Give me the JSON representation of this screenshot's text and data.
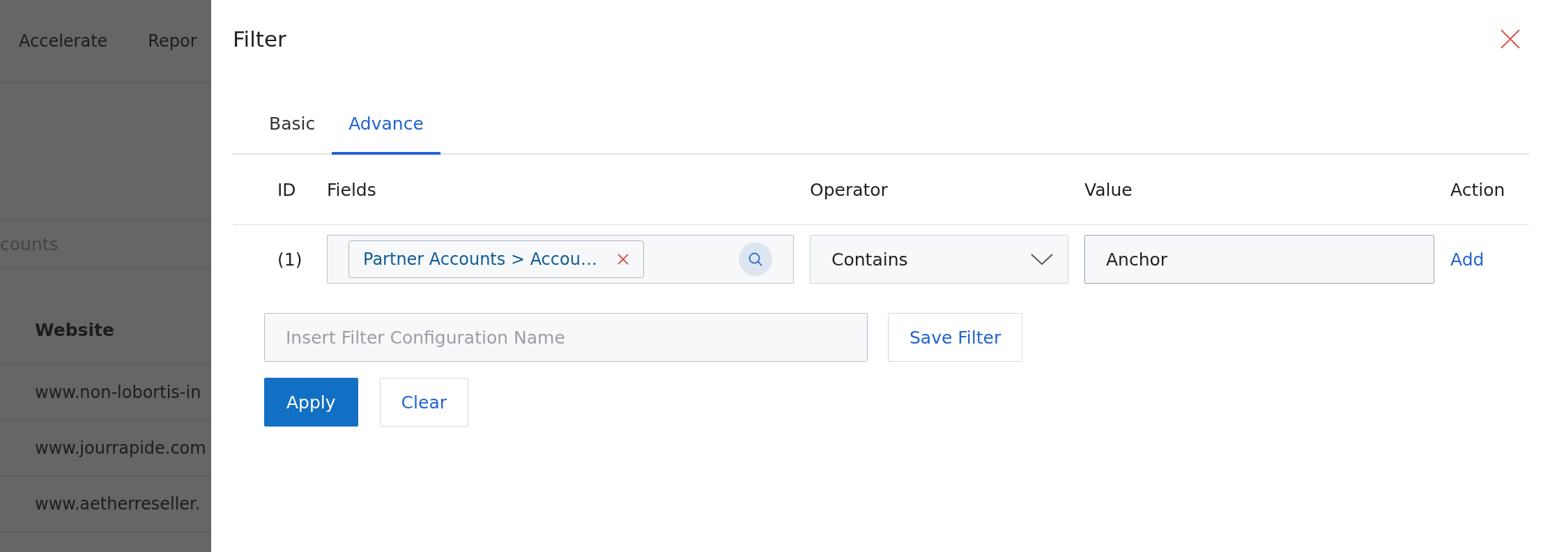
{
  "background": {
    "nav": [
      "Accelerate",
      "Repor"
    ],
    "breadcrumb": "counts",
    "table": {
      "column": "Website",
      "rows": [
        "www.non-lobortis-in",
        "www.jourrapide.com",
        "www.aetherreseller."
      ]
    }
  },
  "dialog": {
    "title": "Filter",
    "tabs": [
      {
        "label": "Basic",
        "selected": false
      },
      {
        "label": "Advance",
        "selected": true
      }
    ],
    "columns": [
      "ID",
      "Fields",
      "Operator",
      "Value",
      "Action"
    ],
    "rows": [
      {
        "id": "(1)",
        "field_chip": "Partner Accounts > Accou…",
        "operator": "Contains",
        "value": "Anchor",
        "action": "Add"
      }
    ],
    "config_name": {
      "placeholder": "Insert Filter Configuration Name"
    },
    "save_button": "Save Filter",
    "buttons": [
      {
        "label": "Apply",
        "kind": "primary"
      },
      {
        "label": "Clear",
        "kind": "secondary"
      }
    ]
  }
}
